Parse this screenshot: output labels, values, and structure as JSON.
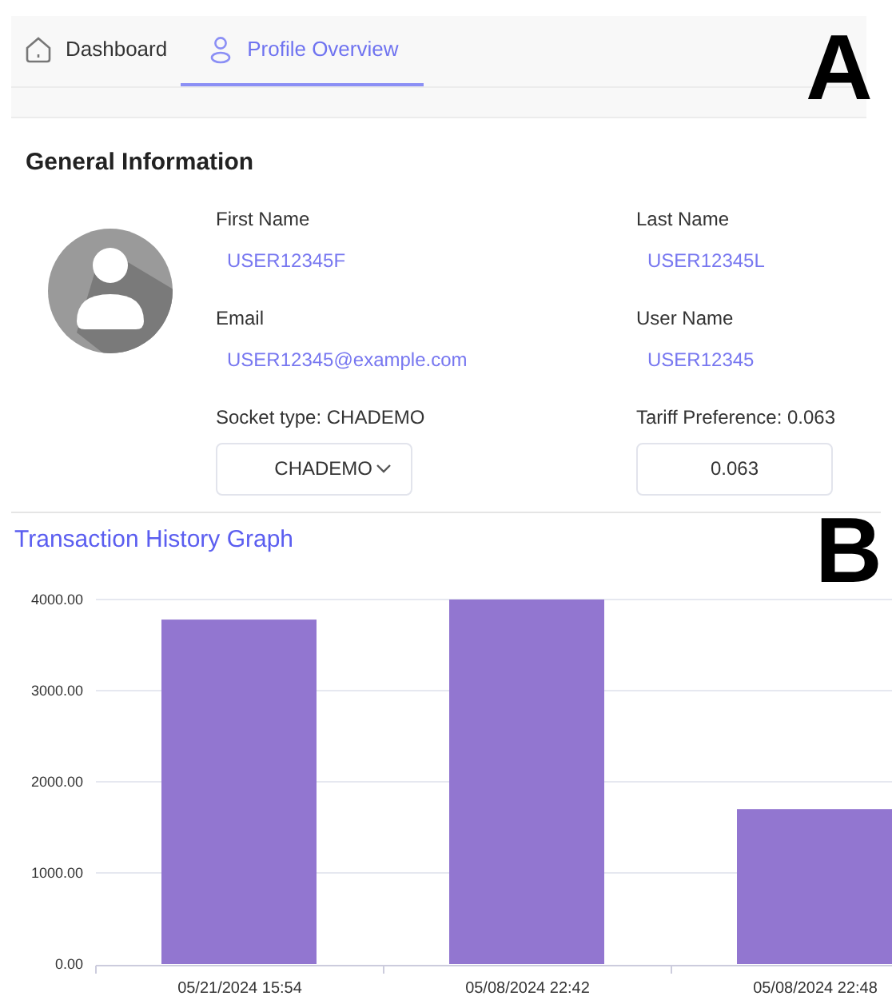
{
  "tabs": [
    {
      "label": "Dashboard",
      "selected": false
    },
    {
      "label": "Profile Overview",
      "selected": true
    }
  ],
  "panel_labels": [
    "A",
    "B"
  ],
  "general_information": {
    "title": "General Information",
    "fields": [
      {
        "label": "First Name",
        "value": "USER12345F"
      },
      {
        "label": "Last Name",
        "value": "USER12345L"
      },
      {
        "label": "Email",
        "value": "USER12345@example.com"
      },
      {
        "label": "User Name",
        "value": "USER12345"
      }
    ],
    "socket_type": {
      "label": "Socket type: CHADEMO",
      "value": "CHADEMO"
    },
    "tariff_preference": {
      "label": "Tariff Preference: 0.063",
      "value": "0.063"
    }
  },
  "transaction_history": {
    "title": "Transaction History Graph",
    "chart_data": {
      "type": "bar",
      "categories": [
        "05/21/2024 15:54",
        "05/08/2024 22:42",
        "05/08/2024 22:48"
      ],
      "series": [
        {
          "color": "#9276d0",
          "values": [
            3780,
            4000,
            1700
          ]
        }
      ],
      "grid": true,
      "ylim": [
        0,
        4000
      ],
      "yticks": [
        {
          "value": 0,
          "label": "0.00"
        },
        {
          "value": 1000,
          "label": "1000.00"
        },
        {
          "value": 2000,
          "label": "2000.00"
        },
        {
          "value": 3000,
          "label": "3000.00"
        },
        {
          "value": 4000,
          "label": "4000.00"
        }
      ]
    }
  }
}
